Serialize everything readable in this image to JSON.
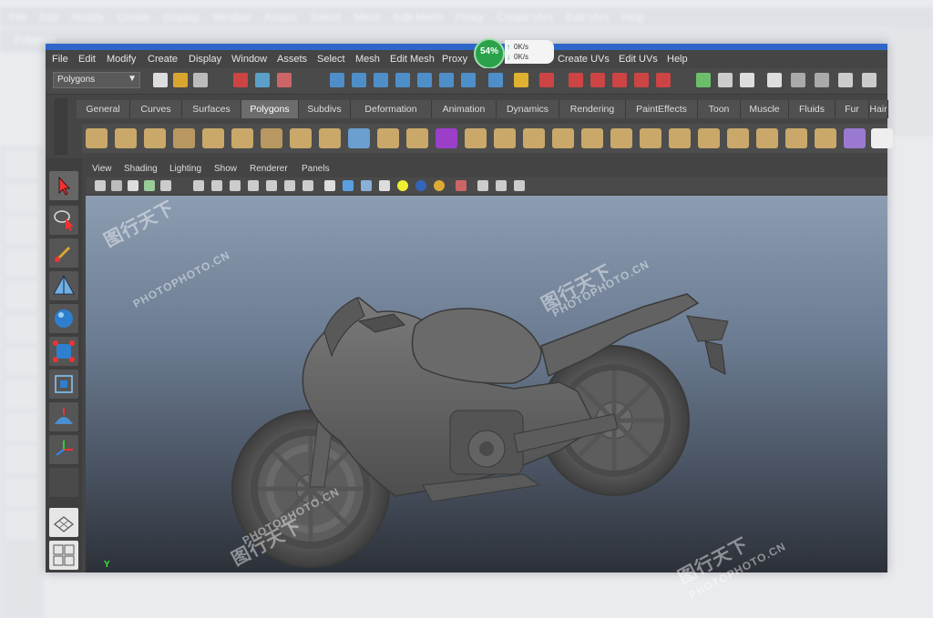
{
  "ghost": {
    "menu": [
      "File",
      "Edit",
      "Modify",
      "Create",
      "Display",
      "Window",
      "Assets",
      "Select",
      "Mesh",
      "Edit Mesh",
      "Proxy",
      "Create UVs",
      "Edit UVs",
      "Help"
    ],
    "mode_label": "Polygons"
  },
  "menu": {
    "items": [
      "File",
      "Edit",
      "Modify",
      "Create",
      "Display",
      "Window",
      "Assets",
      "Select",
      "Mesh",
      "Edit Mesh",
      "Proxy",
      "Create UVs",
      "Edit UVs",
      "Help"
    ]
  },
  "toolbar": {
    "mode_select": "Polygons"
  },
  "progress": {
    "percent_label": "54%",
    "up_rate": "0K/s",
    "down_rate": "0K/s"
  },
  "shelf": {
    "tabs": [
      "General",
      "Curves",
      "Surfaces",
      "Polygons",
      "Subdivs",
      "Deformation",
      "Animation",
      "Dynamics",
      "Rendering",
      "PaintEffects",
      "Toon",
      "Muscle",
      "Fluids",
      "Fur",
      "Hair"
    ],
    "active_tab": "Polygons"
  },
  "panel_menu": {
    "items": [
      "View",
      "Shading",
      "Lighting",
      "Show",
      "Renderer",
      "Panels"
    ]
  },
  "viewport": {
    "subject": "motorcycle-model",
    "axis_label": "Y"
  },
  "watermarks": {
    "url": "PHOTOPHOTO.CN",
    "brand": "图行天下"
  },
  "colors": {
    "title_bar": "#2f66c9",
    "progress_green": "#2aa24a",
    "active_tab": "#6d6d6d",
    "viewport_top": "#8c9db2",
    "viewport_bottom": "#2c3038"
  }
}
